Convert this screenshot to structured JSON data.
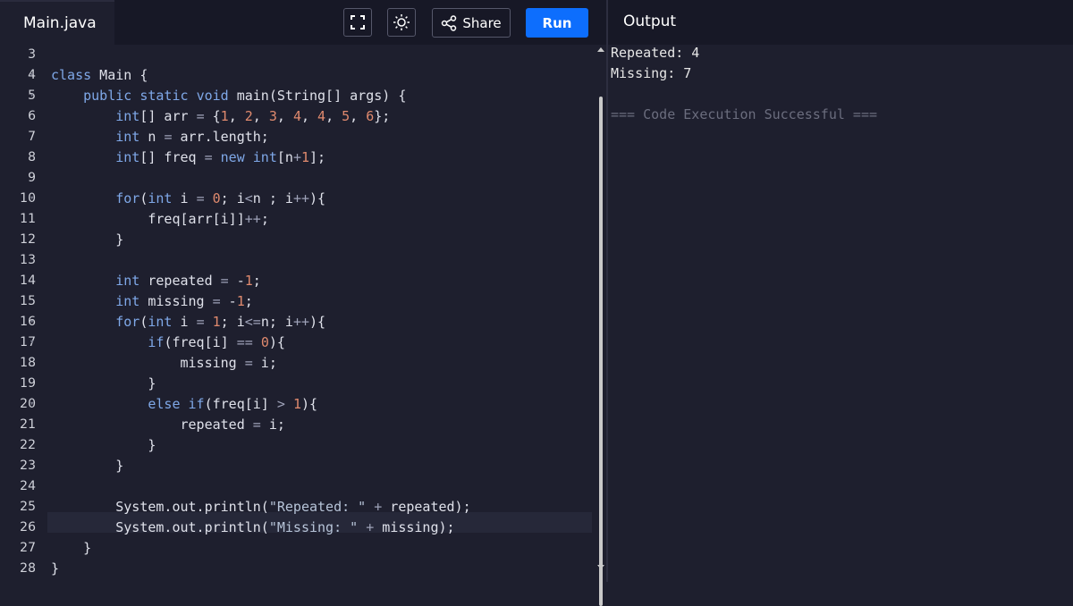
{
  "tabs": {
    "file": "Main.java",
    "output": "Output"
  },
  "toolbar": {
    "fullscreen_icon": "fullscreen-icon",
    "theme_icon": "sun-icon",
    "share_label": "Share",
    "run_label": "Run"
  },
  "colors": {
    "run_button": "#0d6efd",
    "background": "#1e1f2e",
    "topbar": "#171826"
  },
  "editor": {
    "lines": [
      {
        "n": "3",
        "text": ""
      },
      {
        "n": "4",
        "text": "class Main {"
      },
      {
        "n": "5",
        "text": "    public static void main(String[] args) {"
      },
      {
        "n": "6",
        "text": "        int[] arr = {1, 2, 3, 4, 4, 5, 6};"
      },
      {
        "n": "7",
        "text": "        int n = arr.length;"
      },
      {
        "n": "8",
        "text": "        int[] freq = new int[n+1];"
      },
      {
        "n": "9",
        "text": ""
      },
      {
        "n": "10",
        "text": "        for(int i = 0; i<n ; i++){"
      },
      {
        "n": "11",
        "text": "            freq[arr[i]]++;"
      },
      {
        "n": "12",
        "text": "        }"
      },
      {
        "n": "13",
        "text": ""
      },
      {
        "n": "14",
        "text": "        int repeated = -1;"
      },
      {
        "n": "15",
        "text": "        int missing = -1;"
      },
      {
        "n": "16",
        "text": "        for(int i = 1; i<=n; i++){"
      },
      {
        "n": "17",
        "text": "            if(freq[i] == 0){"
      },
      {
        "n": "18",
        "text": "                missing = i;"
      },
      {
        "n": "19",
        "text": "            }"
      },
      {
        "n": "20",
        "text": "            else if(freq[i] > 1){"
      },
      {
        "n": "21",
        "text": "                repeated = i;"
      },
      {
        "n": "22",
        "text": "            }"
      },
      {
        "n": "23",
        "text": "        }"
      },
      {
        "n": "24",
        "text": ""
      },
      {
        "n": "25",
        "text": "        System.out.println(\"Repeated: \" + repeated);"
      },
      {
        "n": "26",
        "text": "        System.out.println(\"Missing: \" + missing);"
      },
      {
        "n": "27",
        "text": "    }"
      },
      {
        "n": "28",
        "text": "}"
      }
    ]
  },
  "output": {
    "lines": [
      "Repeated: 4",
      "Missing: 7",
      "",
      "=== Code Execution Successful ==="
    ]
  }
}
